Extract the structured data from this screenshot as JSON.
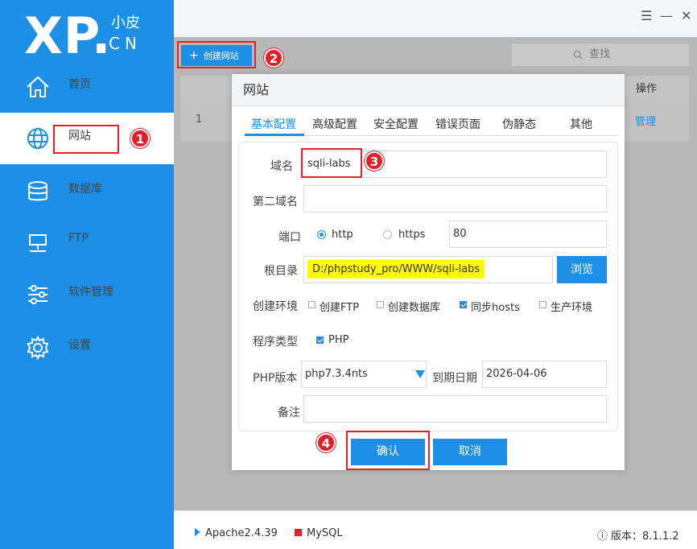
{
  "logo": {
    "xp": "XP.",
    "small": "小皮",
    "cn": "CN"
  },
  "sidebar": {
    "items": [
      {
        "label": "首页",
        "icon": "home-icon"
      },
      {
        "label": "网站",
        "icon": "globe-icon",
        "active": true
      },
      {
        "label": "数据库",
        "icon": "database-icon"
      },
      {
        "label": "FTP",
        "icon": "ftp-icon"
      },
      {
        "label": "软件管理",
        "icon": "sliders-icon"
      },
      {
        "label": "设置",
        "icon": "gear-icon"
      }
    ]
  },
  "window_controls": {
    "menu": "☰",
    "minimize": "—",
    "close": "✕"
  },
  "toolbar": {
    "create_label": "创建网站",
    "create_plus": "+",
    "search_placeholder": "查找"
  },
  "site_table": {
    "op_header": "操作",
    "row_num": "1",
    "manage": "管理"
  },
  "dialog": {
    "title": "网站",
    "tabs": [
      "基本配置",
      "高级配置",
      "安全配置",
      "错误页面",
      "伪静态",
      "其他"
    ],
    "domain_label": "域名",
    "domain_value": "sqli-labs",
    "second_domain_label": "第二域名",
    "second_domain_value": "",
    "port_label": "端口",
    "protocol_http": "http",
    "protocol_https": "https",
    "port_value": "80",
    "root_label": "根目录",
    "root_value": "D:/phpstudy_pro/WWW/sqli-labs",
    "browse": "浏览",
    "env_label": "创建环境",
    "env_options": [
      {
        "label": "创建FTP",
        "checked": false
      },
      {
        "label": "创建数据库",
        "checked": false
      },
      {
        "label": "同步hosts",
        "checked": true
      },
      {
        "label": "生产环境",
        "checked": false
      }
    ],
    "program_label": "程序类型",
    "program_option": "PHP",
    "php_label": "PHP版本",
    "php_value": "php7.3.4nts",
    "expire_label": "到期日期",
    "expire_value": "2026-04-06",
    "note_label": "备注",
    "note_value": "",
    "confirm": "确认",
    "cancel": "取消"
  },
  "annotations": [
    "1",
    "2",
    "3",
    "4"
  ],
  "footer": {
    "apache": "Apache2.4.39",
    "mysql": "MySQL",
    "version_prefix": "ⓘ",
    "version": "版本：8.1.1.2"
  },
  "colors": {
    "accent": "#1e8fe6",
    "annotation_red": "#e0202a",
    "highlight": "#fffb00"
  }
}
